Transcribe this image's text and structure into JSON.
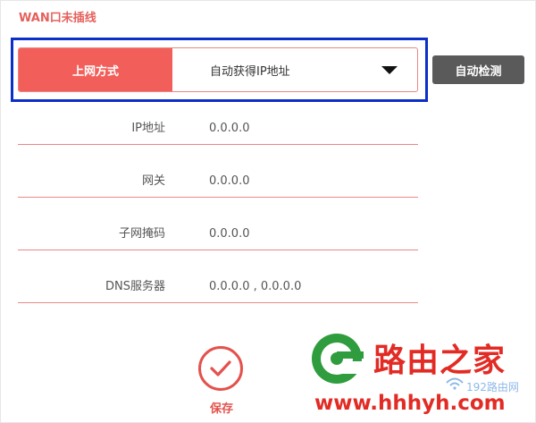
{
  "status": {
    "title": "WAN口未插线"
  },
  "connection": {
    "label": "上网方式",
    "selected": "自动获得IP地址",
    "detect_label": "自动检测"
  },
  "fields": [
    {
      "label": "IP地址",
      "value": "0.0.0.0"
    },
    {
      "label": "网关",
      "value": "0.0.0.0"
    },
    {
      "label": "子网掩码",
      "value": "0.0.0.0"
    },
    {
      "label": "DNS服务器",
      "value": "0.0.0.0 , 0.0.0.0"
    }
  ],
  "save": {
    "label": "保存"
  },
  "watermark": {
    "title": "路由之家",
    "url": "www.hhhyh.com",
    "sub": "192路由网"
  },
  "colors": {
    "accent": "#f25f5b",
    "highlight": "#0b2fc8",
    "button_dark": "#5a5a5a"
  }
}
